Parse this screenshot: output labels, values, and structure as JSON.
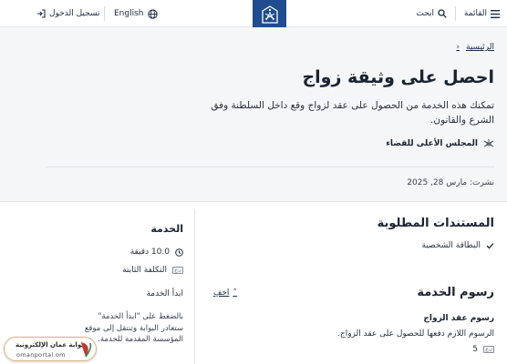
{
  "header": {
    "menu_label": "القائمة",
    "search_label": "ابحث",
    "language_label": "English",
    "login_label": "تسجيل الدخول"
  },
  "breadcrumb": {
    "home": "الرئيسية"
  },
  "service": {
    "title": "احصل على وثيقة زواج",
    "description": "تمكنك هذه الخدمة من الحصول على عقد لزواج وقع داخل السلطنة وفق الشرع والقانون.",
    "agency": "المجلس الأعلى للقضاء",
    "published": "نشرت: مارس 28, 2025"
  },
  "documents": {
    "title": "المستندات المطلوبة",
    "items": [
      "البطاقة الشخصية"
    ]
  },
  "fees": {
    "title": "رسوم الخدمة",
    "toggle_label": "اخفِ",
    "item_name": "رسوم عقد الزواج",
    "item_desc": "الرسوم اللازم دفعها للحصول على عقد الزواج.",
    "item_amount": "5"
  },
  "sidebar": {
    "title": "الخدمة",
    "duration": "10.0 دقيقة",
    "cost": "التكلفة الثابتة",
    "start": "ابدأ الخدمة",
    "note": "بالضغط على \"ابدأ الخدمة\" ستغادر البوابة وتنتقل إلى موقع المؤسسة المقدمة للخدمة."
  },
  "portal": {
    "name": "بوابة عمان الإلكترونية",
    "url": "omanportal.om"
  },
  "colors": {
    "brand": "#1f4d8f",
    "accent_gold": "#d9b57a"
  }
}
